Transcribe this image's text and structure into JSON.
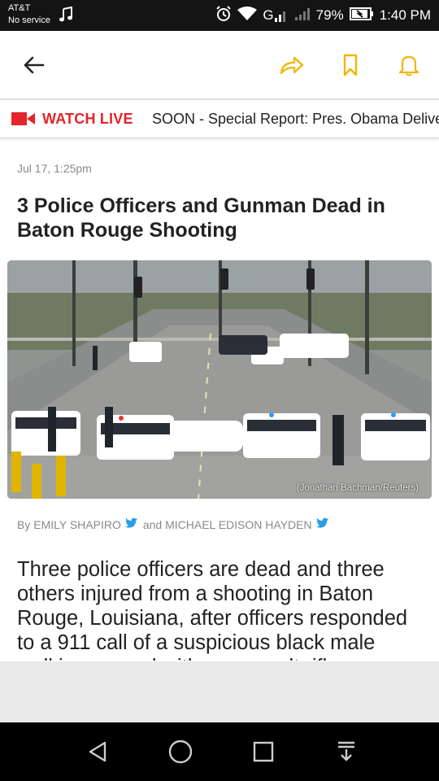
{
  "status_bar": {
    "carrier": "AT&T",
    "service": "No service",
    "battery_percent": "79%",
    "time": "1:40 PM",
    "network": "G"
  },
  "app_bar": {
    "back_icon": "back-arrow-icon",
    "share_icon": "share-icon",
    "bookmark_icon": "bookmark-icon",
    "notification_icon": "bell-icon",
    "accent_color": "#f2b600"
  },
  "live_bar": {
    "label": "WATCH LIVE",
    "ticker": "SOON - Special Report: Pres. Obama Delivers Remarks on Baton Rouge",
    "accent_color": "#e6242b"
  },
  "article": {
    "date": "Jul 17, 1:25pm",
    "headline": "3 Police Officers and Gunman Dead in Baton Rouge Shooting",
    "photo_credit": "(Jonathan Bachman/Reuters)",
    "byline_prefix": "By",
    "author_1": "EMILY SHAPIRO",
    "byline_and": "and",
    "author_2": "MICHAEL EDISON HAYDEN",
    "body": "Three police officers are dead and three others injured from a shooting in Baton Rouge, Louisiana, after officers responded to a 911 call of a suspicious black male walking around with an assault rifle"
  }
}
